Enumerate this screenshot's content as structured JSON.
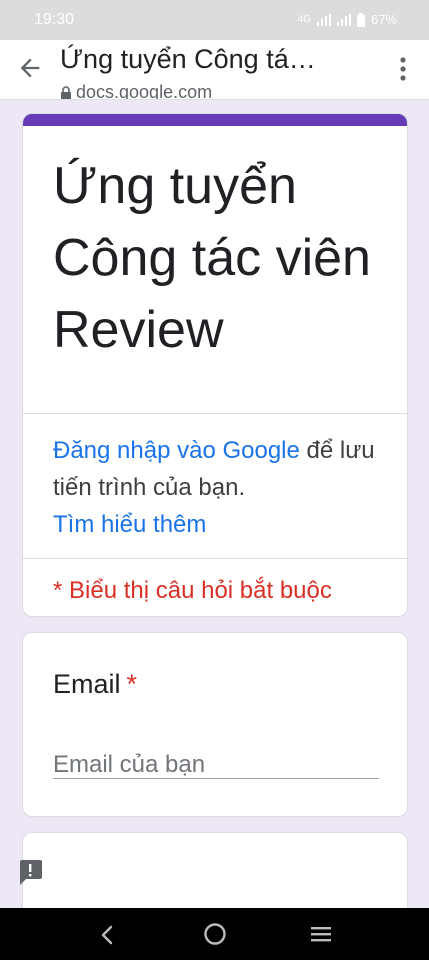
{
  "status_bar": {
    "time": "19:30",
    "network": "4G",
    "battery": "67%",
    "icons": [
      "signal-icon",
      "signal-icon",
      "battery-icon"
    ]
  },
  "browser": {
    "title": "Ứng tuyển Công tá…",
    "url": "docs.google.com",
    "icons": [
      "back-arrow-icon",
      "lock-icon",
      "more-vert-icon"
    ]
  },
  "form": {
    "accent_color": "#673ab7",
    "title": "Ứng tuyển Công tác viên Review",
    "signin_link": "Đăng nhập vào Google",
    "signin_text": " để lưu tiến trình của bạn.",
    "learn_more": "Tìm hiểu thêm",
    "required_note": "* Biểu thị câu hỏi bắt buộc",
    "required_color": "#d93025"
  },
  "questions": [
    {
      "label": "Email",
      "required_mark": "*",
      "placeholder": "Email của bạn",
      "value": ""
    }
  ],
  "feedback": {
    "icon": "report-icon"
  },
  "nav": {
    "icons": [
      "nav-back-icon",
      "nav-home-icon",
      "nav-recents-icon"
    ]
  }
}
